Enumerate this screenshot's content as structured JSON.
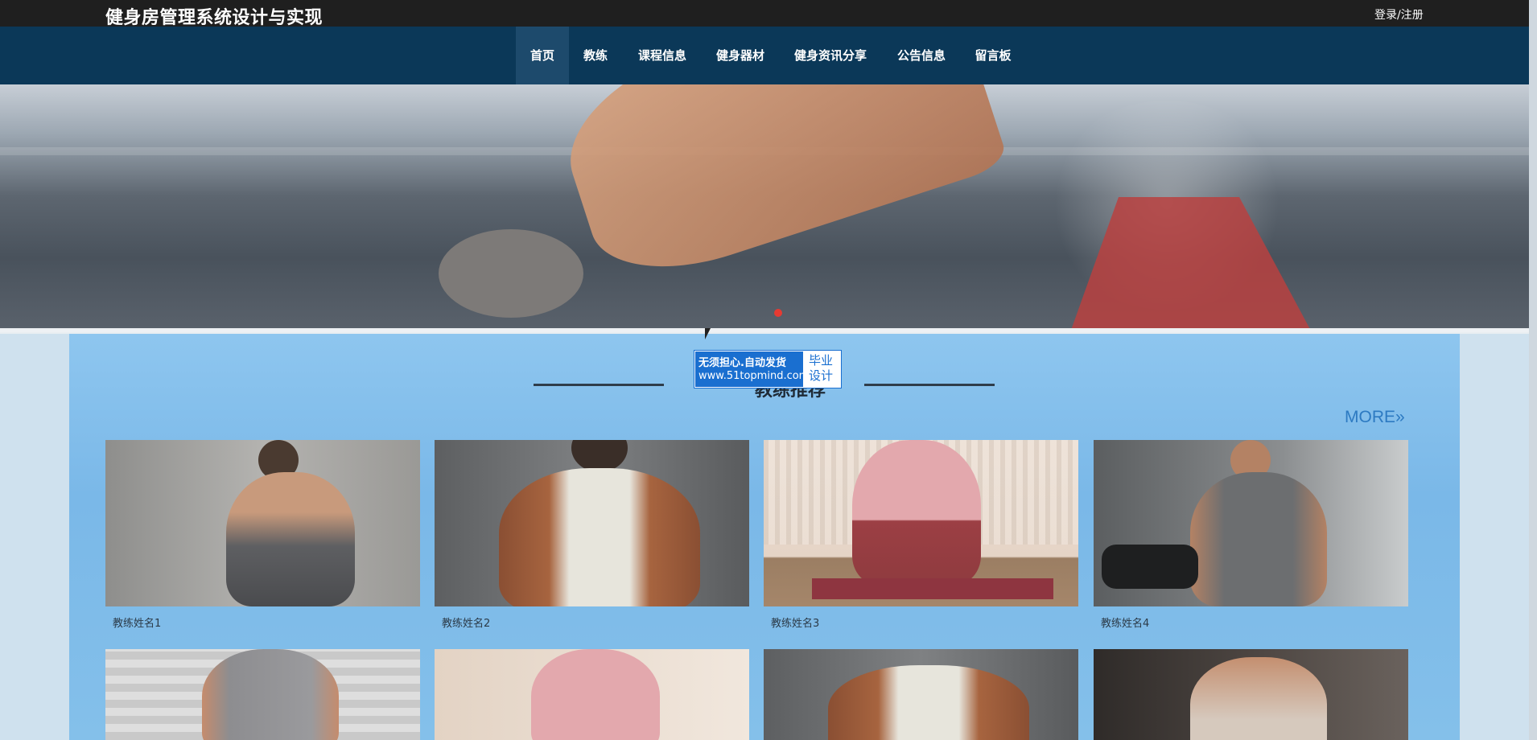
{
  "header": {
    "site_title": "健身房管理系统设计与实现",
    "login_label": "登录/注册"
  },
  "nav": {
    "items": [
      {
        "label": "首页",
        "active": true
      },
      {
        "label": "教练"
      },
      {
        "label": "课程信息"
      },
      {
        "label": "健身器材"
      },
      {
        "label": "健身资讯分享"
      },
      {
        "label": "公告信息"
      },
      {
        "label": "留言板"
      }
    ]
  },
  "hero": {
    "slide_indicator": "carousel-dot"
  },
  "section": {
    "title": "教练推荐",
    "more_label": "MORE»"
  },
  "watermark": {
    "line1": "无须担心.自动发货",
    "line2": "www.51topmind.com",
    "badge_line1": "毕业",
    "badge_line2": "设计"
  },
  "coaches": [
    {
      "name": "教练姓名1"
    },
    {
      "name": "教练姓名2"
    },
    {
      "name": "教练姓名3"
    },
    {
      "name": "教练姓名4"
    }
  ],
  "colors": {
    "topbar": "#1f1f1f",
    "nav": "#0b3858",
    "nav_active": "#1d4a6c",
    "content_bg": "#7ab8e8",
    "more_link": "#2d7ac2"
  }
}
